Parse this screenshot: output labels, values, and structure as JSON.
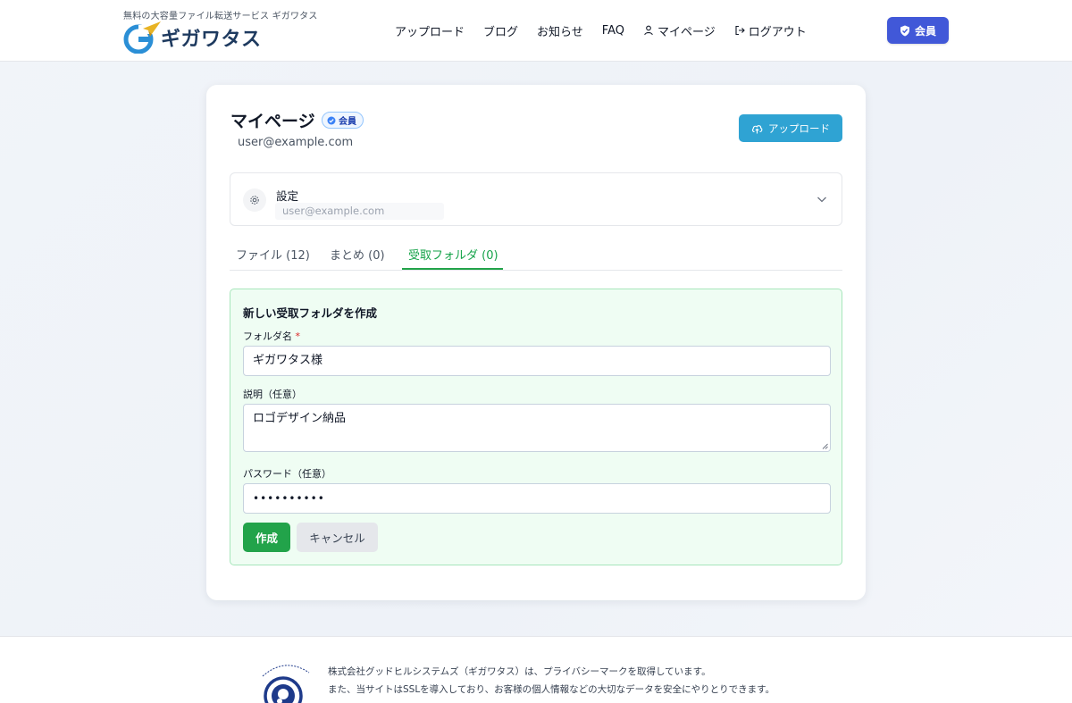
{
  "header": {
    "tagline": "無料の大容量ファイル転送サービス ギガワタス",
    "logo_text": "ギガワタス",
    "nav": [
      {
        "label": "アップロード"
      },
      {
        "label": "ブログ"
      },
      {
        "label": "お知らせ"
      },
      {
        "label": "FAQ"
      },
      {
        "label": "マイページ",
        "icon": "user-icon"
      },
      {
        "label": "ログアウト",
        "icon": "logout-icon"
      }
    ],
    "member_label": "会員",
    "member_icon": "shield-check-icon"
  },
  "mypage": {
    "title": "マイページ",
    "badge": "会員",
    "email": "user@example.com",
    "upload_label": "アップロード",
    "upload_icon": "cloud-upload-icon"
  },
  "settings": {
    "title": "設定",
    "email": "user@example.com",
    "icon": "gear-icon"
  },
  "tabs": [
    {
      "label": "ファイル (12)",
      "active": false
    },
    {
      "label": "まとめ (0)",
      "active": false
    },
    {
      "label": "受取フォルダ (0)",
      "active": true
    }
  ],
  "form": {
    "title": "新しい受取フォルダを作成",
    "folder_name_label": "フォルダ名",
    "required_mark": "*",
    "folder_name_value": "ギガワタス様",
    "description_label": "説明（任意）",
    "description_value": "ロゴデザイン納品",
    "password_label": "パスワード（任意）",
    "password_value": "••••••••••",
    "create_label": "作成",
    "cancel_label": "キャンセル"
  },
  "footer": {
    "privacy_line1": "株式会社グッドヒルシステムズ（ギガワタス）は、プライバシーマークを取得しています。",
    "privacy_line2": "また、当サイトはSSLを導入しており、お客様の個人情報などの大切なデータを安全にやりとりできます。"
  },
  "colors": {
    "member_button": "#4158d8",
    "upload_button": "#2fa3d3",
    "accent_green": "#22a34a",
    "panel_bg": "#effdf3"
  }
}
